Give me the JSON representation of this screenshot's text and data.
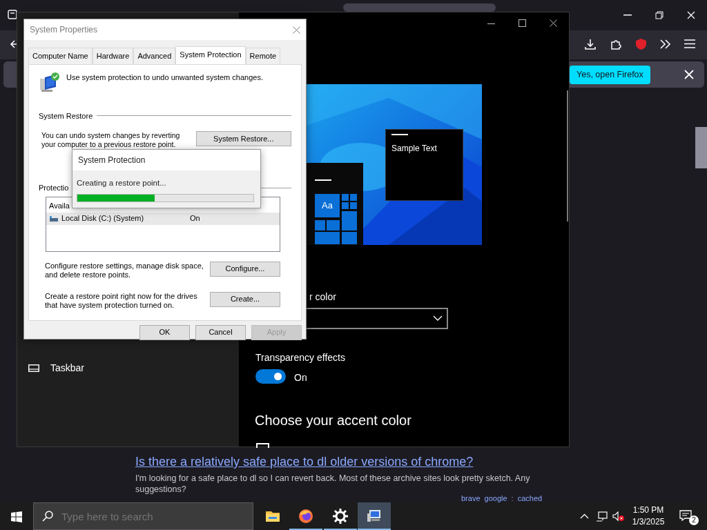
{
  "browser": {
    "notification": {
      "button": "Yes, open Firefox"
    },
    "result": {
      "title": "Is there a relatively safe place to dl older versions of chrome?",
      "snippet": "I'm looking for a safe place to dl so I can revert back. Most of these archive sites look pretty sketch. Any suggestions?",
      "links": [
        "brave",
        "google",
        ":",
        "cached"
      ]
    }
  },
  "settings": {
    "sidebar_items": [
      {
        "label": "Taskbar"
      }
    ],
    "preview": {
      "sample_text": "Sample Text",
      "tile_text": "Aa"
    },
    "partial_label": "r color",
    "transparency": {
      "label": "Transparency effects",
      "on": true,
      "state_text": "On"
    },
    "accent_heading": "Choose your accent color",
    "auto_accent_checkbox": {
      "checked": false
    }
  },
  "system_properties": {
    "title": "System Properties",
    "tabs": [
      {
        "label": "Computer Name",
        "selected": false
      },
      {
        "label": "Hardware",
        "selected": false
      },
      {
        "label": "Advanced",
        "selected": false
      },
      {
        "label": "System Protection",
        "selected": true
      },
      {
        "label": "Remote",
        "selected": false
      }
    ],
    "intro": "Use system protection to undo unwanted system changes.",
    "restore_section": "System Restore",
    "restore_text": "You can undo system changes by reverting your computer to a previous restore point.",
    "restore_button": "System Restore...",
    "protection_section": "Protectio",
    "drives": {
      "header": "Availa",
      "rows": [
        {
          "name": "Local Disk (C:) (System)",
          "status": "On",
          "selected": true
        }
      ]
    },
    "configure_text": "Configure restore settings, manage disk space, and delete restore points.",
    "configure_button": "Configure...",
    "create_text": "Create a restore point right now for the drives that have system protection turned on.",
    "create_button": "Create...",
    "buttons": [
      {
        "label": "OK",
        "disabled": false
      },
      {
        "label": "Cancel",
        "disabled": false
      },
      {
        "label": "Apply",
        "disabled": true
      }
    ]
  },
  "progress_dialog": {
    "title": "System Protection",
    "message": "Creating a restore point...",
    "level": 0.44
  },
  "taskbar": {
    "search_placeholder": "Type here to search",
    "apps": [
      {
        "kind": "folder",
        "running": false,
        "selected": false
      },
      {
        "kind": "firefox",
        "running": true,
        "selected": false
      },
      {
        "kind": "settings",
        "running": true,
        "selected": false
      },
      {
        "kind": "sysprop",
        "running": true,
        "selected": true
      }
    ],
    "clock": {
      "time": "1:50 PM",
      "date": "1/3/2025"
    },
    "notification_count": "2"
  }
}
